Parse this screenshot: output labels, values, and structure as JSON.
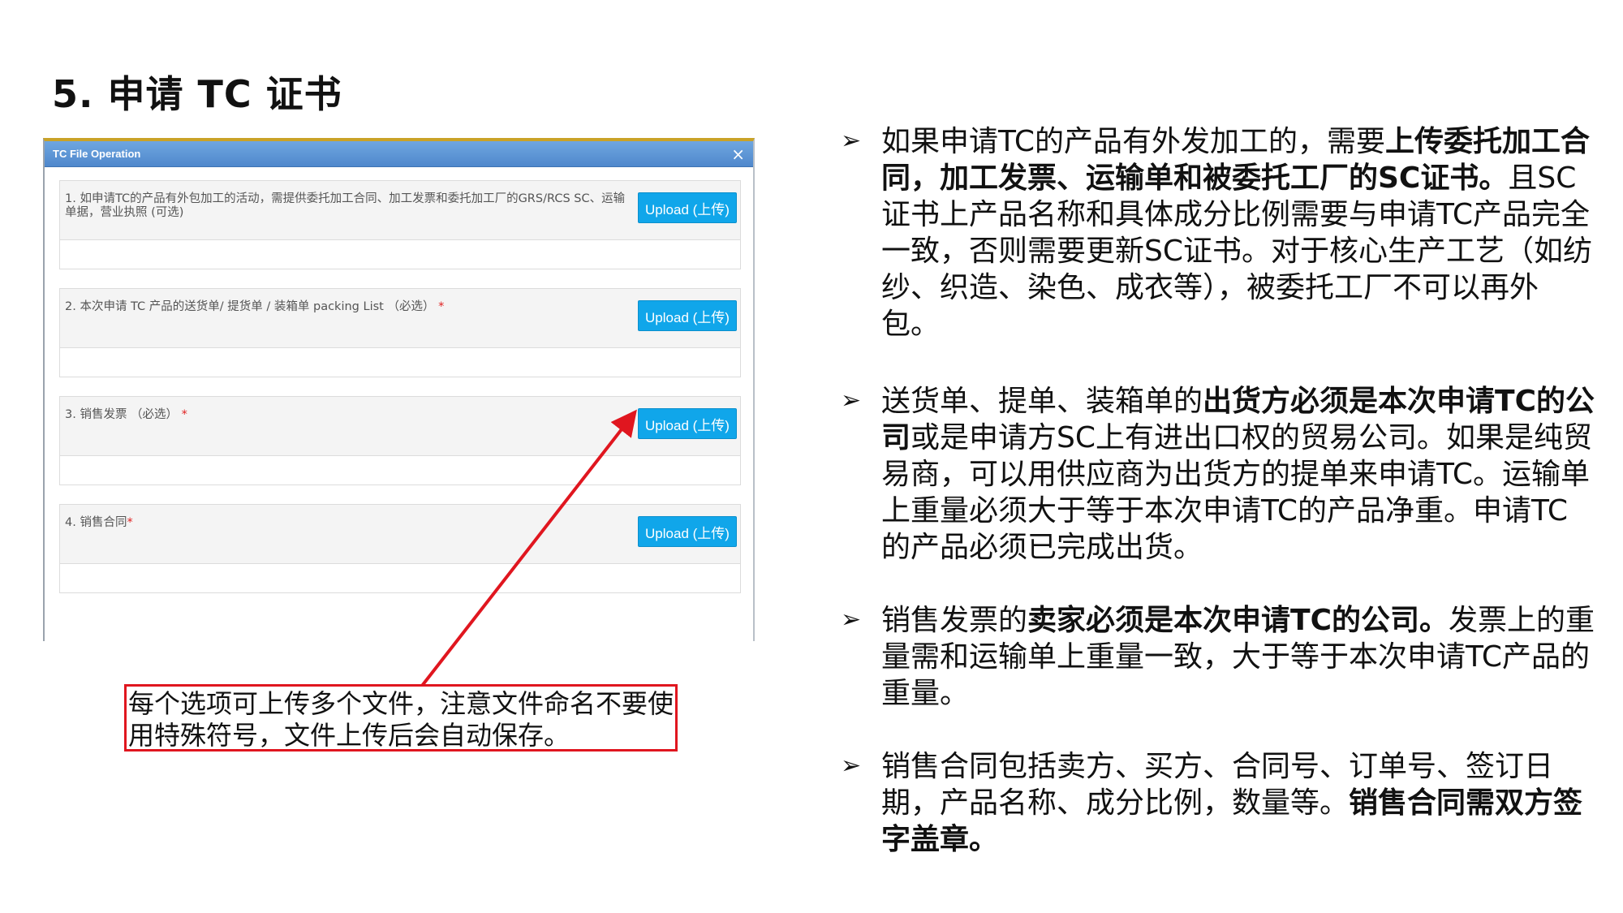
{
  "slide": {
    "title": "5. 申请 TC 证书"
  },
  "dialog": {
    "title": "TC File Operation",
    "close_icon": "×",
    "items": [
      {
        "label": "1. 如申请TC的产品有外包加工的活动，需提供委托加工合同、加工发票和委托加工厂的GRS/RCS SC、运输单据，营业执照 (可选)",
        "required_mark": "",
        "button": "Upload (上传)"
      },
      {
        "label": "2. 本次申请 TC 产品的送货单/ 提货单 / 装箱单 packing List （必选）",
        "required_mark": "*",
        "button": "Upload (上传)"
      },
      {
        "label": "3. 销售发票 （必选）",
        "required_mark": "*",
        "button": "Upload (上传)"
      },
      {
        "label": "4. 销售合同",
        "required_mark": "*",
        "button": "Upload (上传)"
      }
    ]
  },
  "callout": {
    "text": "每个选项可上传多个文件，注意文件命名不要使用特殊符号，文件上传后会自动保存。",
    "border_color": "#e0161f"
  },
  "bullets": {
    "marker": "➢",
    "items": [
      {
        "parts": [
          {
            "text": "如果申请TC的产品有外发加工的，需要",
            "bold": false
          },
          {
            "text": "上传委托加工合同，加工发票、运输单和被委托工厂的SC证书。",
            "bold": true
          },
          {
            "text": "且SC证书上产品名称和具体成分比例需要与申请TC产品完全一致，否则需要更新SC证书。对于核心生产工艺（如纺纱、织造、染色、成衣等），被委托工厂不可以再外包。",
            "bold": false
          }
        ]
      },
      {
        "parts": [
          {
            "text": "送货单、提单、装箱单的",
            "bold": false
          },
          {
            "text": "出货方必须是本次申请TC的公司",
            "bold": true
          },
          {
            "text": "或是申请方SC上有进出口权的贸易公司。如果是纯贸易商，可以用供应商为出货方的提单来申请TC。运输单上重量必须大于等于本次申请TC的产品净重。申请TC的产品必须已完成出货。",
            "bold": false
          }
        ]
      },
      {
        "parts": [
          {
            "text": "销售发票的",
            "bold": false
          },
          {
            "text": "卖家必须是本次申请TC的公司。",
            "bold": true
          },
          {
            "text": "发票上的重量需和运输单上重量一致，大于等于本次申请TC产品的重量。",
            "bold": false
          }
        ]
      },
      {
        "parts": [
          {
            "text": "销售合同包括卖方、买方、合同号、订单号、签订日期，产品名称、成分比例，数量等。",
            "bold": false
          },
          {
            "text": "销售合同需双方签字盖章。",
            "bold": true
          }
        ]
      }
    ]
  }
}
